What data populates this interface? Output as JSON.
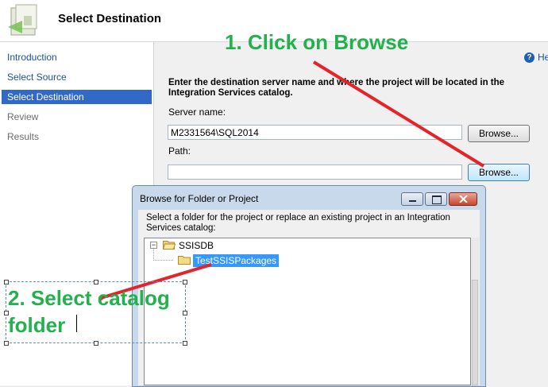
{
  "header": {
    "title": "Select Destination",
    "icon": "wizard-destination-icon"
  },
  "sidebar": {
    "items": [
      {
        "label": "Introduction",
        "state": "link"
      },
      {
        "label": "Select Source",
        "state": "link"
      },
      {
        "label": "Select Destination",
        "state": "active"
      },
      {
        "label": "Review",
        "state": "disabled"
      },
      {
        "label": "Results",
        "state": "disabled"
      }
    ]
  },
  "main": {
    "help_label": "He",
    "instructions": "Enter the destination server name and where the project will be located in the Integration Services catalog.",
    "server_label": "Server name:",
    "server_value": "M2331564\\SQL2014",
    "path_label": "Path:",
    "path_value": "",
    "browse_label": "Browse..."
  },
  "dialog": {
    "title": "Browse for Folder or Project",
    "description": "Select a folder for the project or replace an existing project in an Integration Services catalog:",
    "tree": {
      "root": "SSISDB",
      "child": "TestSSISPackages"
    }
  },
  "annotations": {
    "step1": "1. Click on Browse",
    "step2": "2. Select catalog folder"
  },
  "colors": {
    "accent": "#3169c6",
    "annotation_text": "#22b14c",
    "annotation_arrow": "#e52329",
    "selection": "#3399ff"
  }
}
